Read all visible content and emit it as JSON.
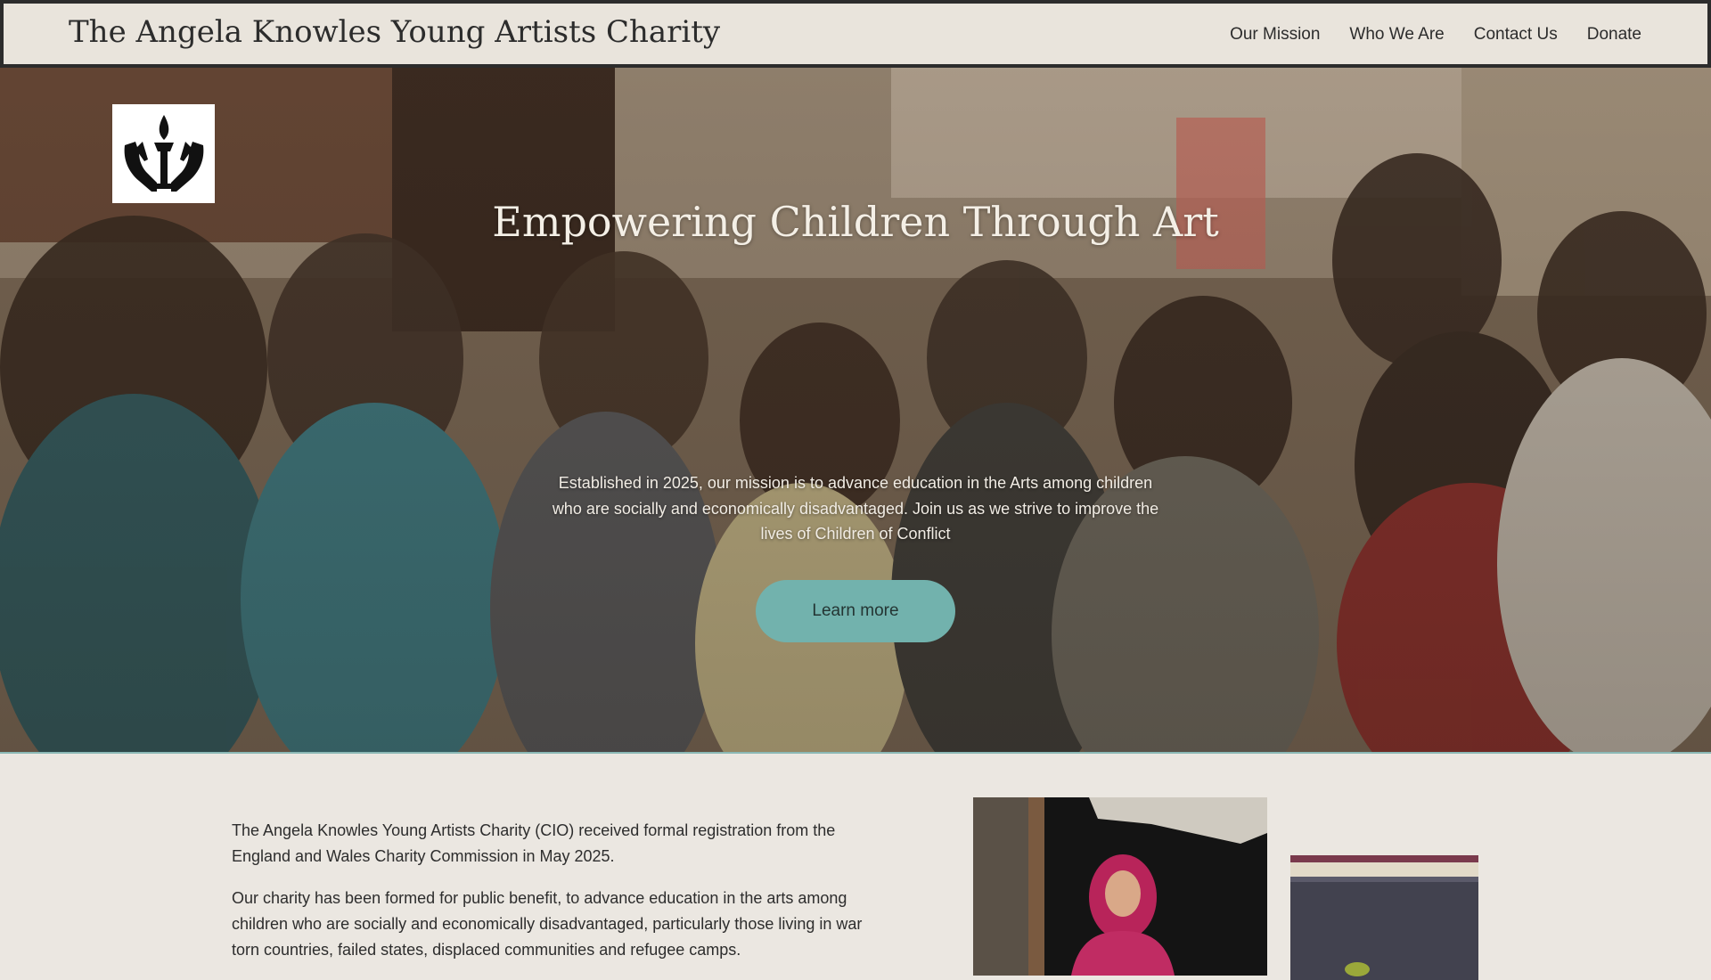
{
  "header": {
    "site_title": "The Angela Knowles Young Artists Charity",
    "nav": [
      {
        "label": "Our Mission"
      },
      {
        "label": "Who We Are"
      },
      {
        "label": "Contact Us"
      },
      {
        "label": "Donate"
      }
    ]
  },
  "hero": {
    "title": "Empowering Children Through Art",
    "text": "Established in 2025, our mission is to advance education in the Arts among children who are socially and economically disadvantaged. Join us as we strive to improve the lives of Children of Conflict",
    "cta_label": "Learn more",
    "logo_icon": "torch-hands-icon"
  },
  "content": {
    "paragraphs": [
      "The Angela Knowles Young Artists Charity (CIO) received formal registration from the England and Wales Charity Commission in May 2025.",
      "Our charity has been formed for  public benefit, to advance education in the arts among children who are socially and economically disadvantaged, particularly those living in war torn countries, failed states, displaced communities and refugee camps."
    ]
  },
  "colors": {
    "accent": "#72b2ad",
    "background": "#ebe7e1",
    "text": "#2c2c2c"
  }
}
